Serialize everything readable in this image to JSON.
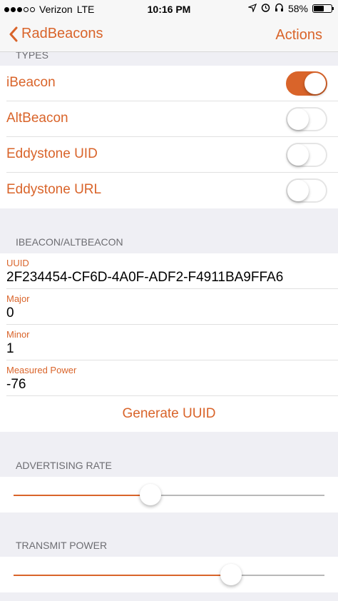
{
  "status": {
    "carrier": "Verizon",
    "network": "LTE",
    "time": "10:16 PM",
    "battery": "58%",
    "battery_level": 0.58
  },
  "nav": {
    "back_label": "RadBeacons",
    "actions_label": "Actions"
  },
  "types": {
    "header": "TYPES",
    "items": [
      {
        "label": "iBeacon",
        "on": true
      },
      {
        "label": "AltBeacon",
        "on": false
      },
      {
        "label": "Eddystone UID",
        "on": false
      },
      {
        "label": "Eddystone URL",
        "on": false
      }
    ]
  },
  "ibeacon": {
    "header": "IBEACON/ALTBEACON",
    "fields": [
      {
        "label": "UUID",
        "value": "2F234454-CF6D-4A0F-ADF2-F4911BA9FFA6"
      },
      {
        "label": "Major",
        "value": "0"
      },
      {
        "label": "Minor",
        "value": "1"
      },
      {
        "label": "Measured Power",
        "value": "-76"
      }
    ],
    "generate_label": "Generate UUID"
  },
  "advertising": {
    "header": "ADVERTISING RATE",
    "level": 0.44
  },
  "transmit": {
    "header": "TRANSMIT POWER",
    "level": 0.7
  },
  "colors": {
    "accent": "#d9642a",
    "background": "#efeff4"
  }
}
